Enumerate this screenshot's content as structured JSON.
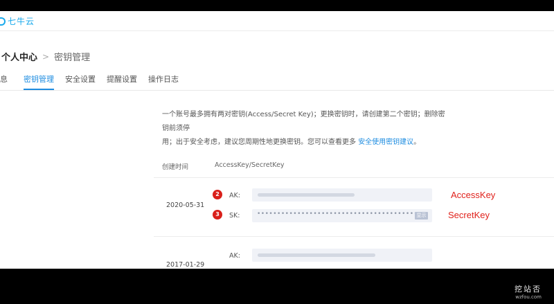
{
  "header": {
    "logo_text": "七牛云"
  },
  "breadcrumb": {
    "root": "个人中心",
    "separator": ">",
    "current": "密钥管理"
  },
  "tabs": [
    {
      "label": "息"
    },
    {
      "label": "密钥管理"
    },
    {
      "label": "安全设置"
    },
    {
      "label": "提醒设置"
    },
    {
      "label": "操作日志"
    }
  ],
  "description": {
    "line1": "一个账号最多拥有两对密钥(Access/Secret Key)；更换密钥时，请创建第二个密钥；删除密钥前须停",
    "line2": "用；出于安全考虑，建议您周期性地更换密钥。您可以查看更多 ",
    "link": "安全使用密钥建议",
    "line2_end": "。"
  },
  "table": {
    "columns": [
      "创建时间",
      "AccessKey/SecretKey"
    ],
    "rows": [
      {
        "date": "2020-05-31",
        "ak_label": "AK:",
        "sk_label": "SK:",
        "sk_masked": "••••••••••••••••••••••••••••••••••••••••",
        "show_label": "显示"
      },
      {
        "date": "2017-01-29",
        "ak_label": "AK:"
      }
    ]
  },
  "annotations": {
    "badge_ak": "2",
    "badge_sk": "3",
    "ak_note": "AccessKey",
    "sk_note": "SecretKey"
  },
  "watermark": {
    "zh": "挖站否",
    "en": "wzfou.com"
  },
  "colors": {
    "accent": "#1d8ce0",
    "logo": "#18a9ec",
    "annotation": "#e0211b"
  }
}
